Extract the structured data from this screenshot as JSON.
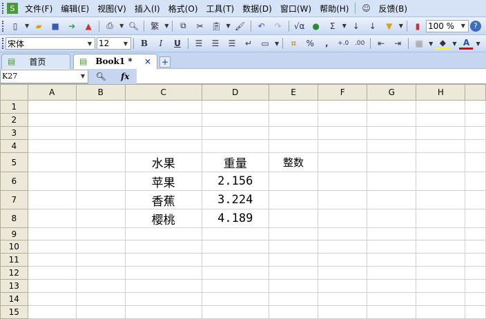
{
  "menu": [
    "文件(F)",
    "编辑(E)",
    "视图(V)",
    "插入(I)",
    "格式(O)",
    "工具(T)",
    "数据(D)",
    "窗口(W)",
    "帮助(H)",
    "反馈(B)"
  ],
  "toolbar": {
    "zoom": "100 %",
    "traditional": "繁",
    "sum": "Σ",
    "sqrt": "√α"
  },
  "format": {
    "font": "宋体",
    "size": "12",
    "bold": "B",
    "italic": "I",
    "underline": "U",
    "percent": "%",
    "thousands": "‚",
    "inc_decimal": "+.0",
    "dec_decimal": ".00"
  },
  "tabs": {
    "home": "首页",
    "book": "Book1 *",
    "close": "×",
    "add": "+"
  },
  "formula": {
    "cell_ref": "K27",
    "fx": "fx"
  },
  "columns": [
    "A",
    "B",
    "C",
    "D",
    "E",
    "F",
    "G",
    "H"
  ],
  "rows": [
    "1",
    "2",
    "3",
    "4",
    "5",
    "6",
    "7",
    "8",
    "9",
    "10",
    "11",
    "12",
    "13",
    "14",
    "15"
  ],
  "cells": {
    "C5": "水果",
    "D5": "重量",
    "E5": "整数",
    "C6": "苹果",
    "D6": "2.156",
    "C7": "香蕉",
    "D7": "3.224",
    "C8": "樱桃",
    "D8": "4.189"
  }
}
